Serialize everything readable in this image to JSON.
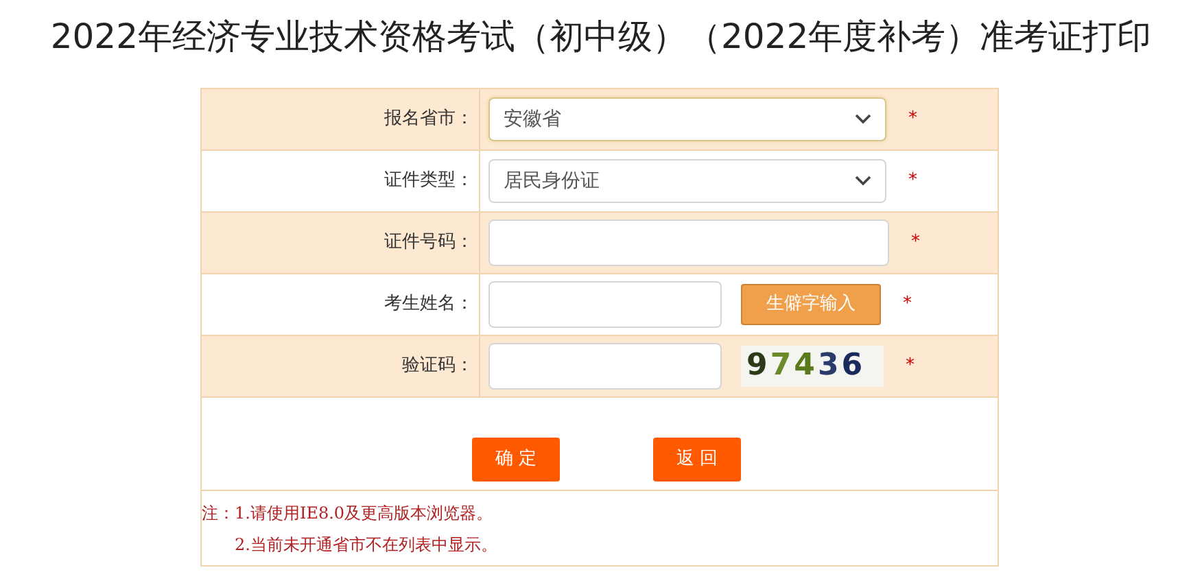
{
  "title": "2022年经济专业技术资格考试（初中级）（2022年度补考）准考证打印",
  "rows": [
    {
      "kind": "select",
      "label": "报名省市：",
      "value": "安徽省",
      "focused": true,
      "required": "*"
    },
    {
      "kind": "select",
      "label": "证件类型：",
      "value": "居民身份证",
      "focused": false,
      "required": "*"
    },
    {
      "kind": "input",
      "label": "证件号码：",
      "required": "*"
    },
    {
      "kind": "input_button",
      "label": "考生姓名：",
      "button": "生僻字输入",
      "required": "*"
    },
    {
      "kind": "captcha",
      "label": "验证码：",
      "captcha": "97436",
      "required": "*"
    }
  ],
  "buttons": [
    "确 定",
    "返 回"
  ],
  "notes": [
    "注：1.请使用IE8.0及更高版本浏览器。",
    "2.当前未开通省市不在列表中显示。"
  ]
}
